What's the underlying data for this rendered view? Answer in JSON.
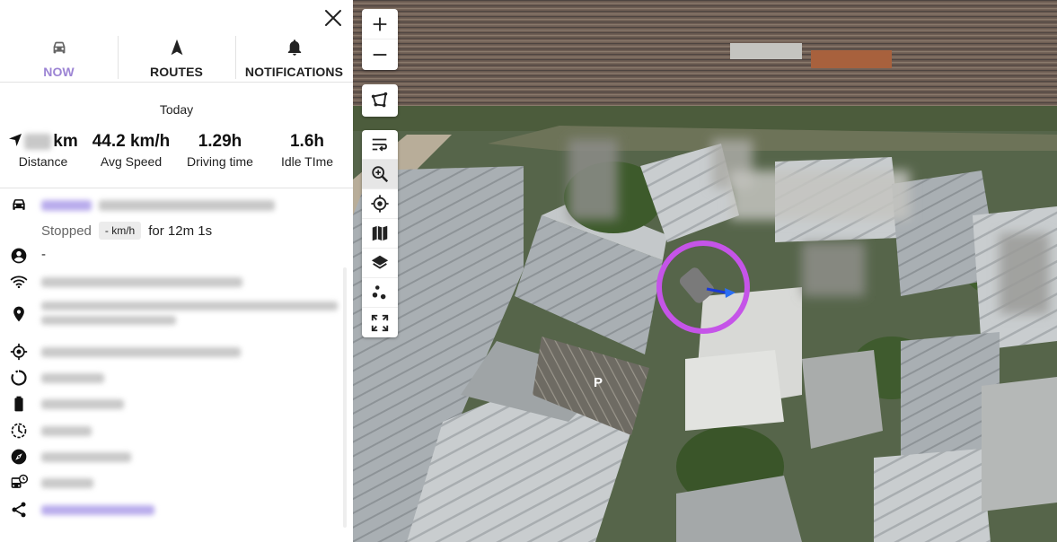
{
  "tabs": [
    {
      "label": "NOW",
      "icon": "car-icon",
      "active": true
    },
    {
      "label": "ROUTES",
      "icon": "navigation-arrow-icon",
      "active": false
    },
    {
      "label": "NOTIFICATIONS",
      "icon": "bell-icon",
      "active": false
    }
  ],
  "summary": {
    "period": "Today",
    "distance_unit": "km",
    "distance_label": "Distance",
    "avg_speed": "44.2 km/h",
    "avg_speed_label": "Avg Speed",
    "driving_time": "1.29h",
    "driving_time_label": "Driving time",
    "idle_time": "1.6h",
    "idle_time_label": "Idle TIme"
  },
  "vehicle": {
    "status": "Stopped",
    "speed": "- km/h",
    "duration": "for 12m 1s",
    "driver": "-"
  },
  "map": {
    "parking_label": "P",
    "highlight_color": "#c554e8",
    "heading_color": "#1a3ad6"
  },
  "colors": {
    "accent": "#9c84d4"
  }
}
